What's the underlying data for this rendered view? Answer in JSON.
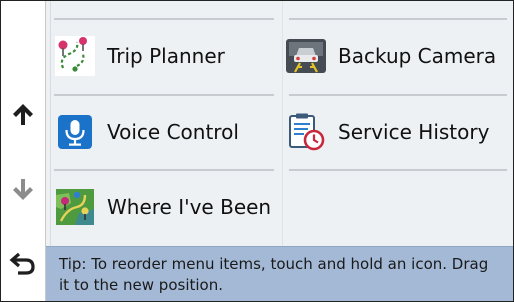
{
  "menu": {
    "items": [
      {
        "label": "Trip Planner",
        "icon": "trip-planner-icon"
      },
      {
        "label": "Backup Camera",
        "icon": "backup-camera-icon"
      },
      {
        "label": "Voice Control",
        "icon": "microphone-icon"
      },
      {
        "label": "Service History",
        "icon": "service-history-icon"
      },
      {
        "label": "Where I've Been",
        "icon": "where-ive-been-icon"
      }
    ]
  },
  "sidebar": {
    "up_icon": "arrow-up-icon",
    "down_icon": "arrow-down-icon",
    "back_icon": "back-arrow-icon"
  },
  "tip": {
    "text": "Tip: To reorder menu items, touch and hold an icon. Drag it to the new position."
  },
  "colors": {
    "panel_bg": "#eef1f4",
    "tip_bg": "#a4b9d6",
    "divider": "#c8ccd1"
  }
}
